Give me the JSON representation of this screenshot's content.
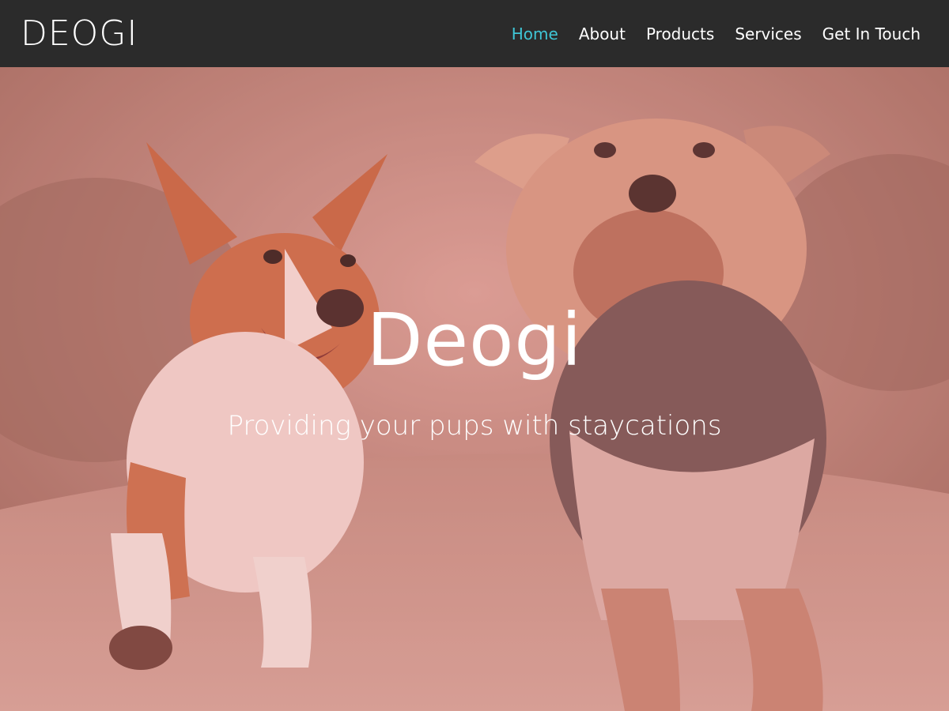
{
  "nav": {
    "logo": "DEOGI",
    "links": [
      {
        "label": "Home",
        "active": true
      },
      {
        "label": "About",
        "active": false
      },
      {
        "label": "Products",
        "active": false
      },
      {
        "label": "Services",
        "active": false
      },
      {
        "label": "Get In Touch",
        "active": false
      }
    ]
  },
  "hero": {
    "title": "Deogi",
    "subtitle": "Providing your pups with staycations",
    "image": "two-dogs-running-photo"
  },
  "colors": {
    "navbar_bg": "#2b2b2b",
    "active_link": "#3fc6d6",
    "text": "#ffffff"
  }
}
